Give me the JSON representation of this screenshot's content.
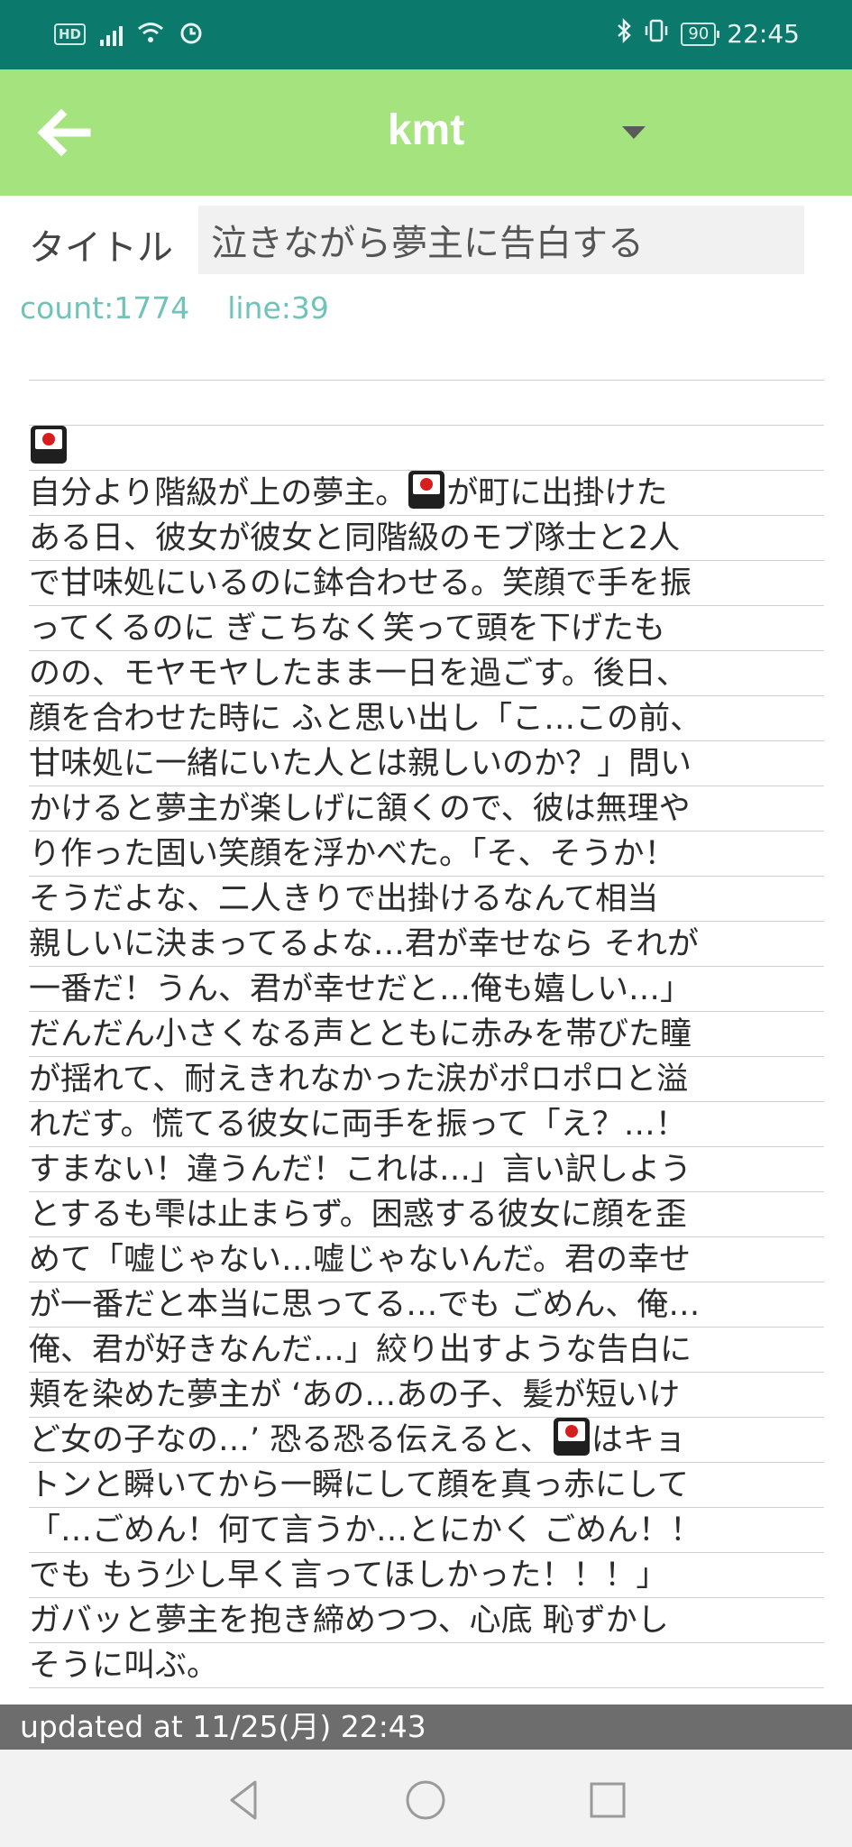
{
  "status_bar": {
    "left_icons": [
      "hd-icon",
      "signal-icon",
      "wifi-icon",
      "alarm-icon"
    ],
    "hd_label": "HD",
    "right_icons": [
      "bluetooth-icon",
      "vibrate-icon"
    ],
    "battery": "90",
    "time": "22:45",
    "background": "#0b7a6c"
  },
  "app_bar": {
    "title": "kmt",
    "back_icon": "arrow-left-icon",
    "dropdown_icon": "caret-down-icon",
    "background": "#a4e37e"
  },
  "form": {
    "title_label": "タイトル",
    "title_value": "泣きながら夢主に告白する"
  },
  "meta": {
    "count": "count:1774",
    "line": "line:39",
    "color": "#6fc3b8"
  },
  "body": {
    "emoji_icon": "japanese-flag-emoji-icon",
    "lines": [
      "",
      "",
      "[E]",
      "自分より階級が上の夢主。[E]が町に出掛けた",
      "ある日、彼女が彼女と同階級のモブ隊士と2人",
      "で甘味処にいるのに鉢合わせる。笑顔で手を振",
      "ってくるのに ぎこちなく笑って頭を下げたも",
      "のの、モヤモヤしたまま一日を過ごす。後日、",
      "顔を合わせた時に ふと思い出し「こ…この前、",
      "甘味処に一緒にいた人とは親しいのか？」問い",
      "かけると夢主が楽しげに頷くので、彼は無理や",
      "り作った固い笑顔を浮かべた。「そ、そうか！",
      "そうだよな、二人きりで出掛けるなんて相当",
      "親しいに決まってるよな…君が幸せなら それが",
      "一番だ！うん、君が幸せだと…俺も嬉しい…」",
      "だんだん小さくなる声とともに赤みを帯びた瞳",
      "が揺れて、耐えきれなかった涙がポロポロと溢",
      "れだす。慌てる彼女に両手を振って「え？…！",
      "すまない！違うんだ！これは…」言い訳しよう",
      "とするも雫は止まらず。困惑する彼女に顔を歪",
      "めて「嘘じゃない…嘘じゃないんだ。君の幸せ",
      "が一番だと本当に思ってる…でも ごめん、俺…",
      "俺、君が好きなんだ…」絞り出すような告白に",
      "頬を染めた夢主が ‘あの…あの子、髪が短いけ",
      "ど女の子なの…’ 恐る恐る伝えると、[E]はキョ",
      "トンと瞬いてから一瞬にして顔を真っ赤にして",
      "「…ごめん！何て言うか…とにかく ごめん！！",
      "でも もう少し早く言ってほしかった！！！」",
      "ガバッと夢主を抱き締めつつ、心底 恥ずかし",
      "そうに叫ぶ。",
      ""
    ]
  },
  "footer": {
    "updated": "updated at 11/25(月) 22:43"
  },
  "nav_bar": {
    "icons": [
      "back-triangle-icon",
      "home-circle-icon",
      "recents-square-icon"
    ]
  }
}
